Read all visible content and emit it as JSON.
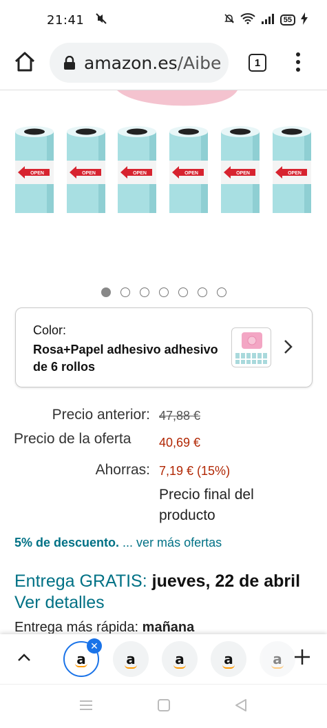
{
  "status_bar": {
    "time": "21:41",
    "battery": "55",
    "icons": [
      "mute-icon",
      "alarm-off-icon",
      "wifi-icon",
      "signal-icon",
      "battery-icon",
      "charging-icon"
    ]
  },
  "browser": {
    "url_domain": "amazon.es",
    "url_path": "/Aibe",
    "tab_count": "1"
  },
  "carousel": {
    "total": 7,
    "active": 0,
    "roll_label": "OPEN"
  },
  "color_selector": {
    "label": "Color:",
    "value": "Rosa+Papel adhesivo adhesivo de 6 rollos"
  },
  "pricing": {
    "previous_label": "Precio anterior:",
    "previous_value": "47,88 €",
    "offer_label": "Precio de la oferta",
    "offer_value": "40,69 €",
    "savings_label": "Ahorras:",
    "savings_value": "7,19 € (15%)",
    "final_note": "Precio final del producto"
  },
  "discount": {
    "bold": "5% de descuento.",
    "link": " ... ver más ofertas"
  },
  "delivery": {
    "prefix": "Entrega GRATIS:",
    "date": "jueves, 22 de abril",
    "details_link": "Ver detalles",
    "faster_label": "Entrega más rápida:",
    "faster_value": "mañana"
  },
  "tab_strip": {
    "tab_letter": "a"
  },
  "colors": {
    "link": "#007185",
    "price_red": "#b12704",
    "active_tab": "#1a73e8"
  }
}
